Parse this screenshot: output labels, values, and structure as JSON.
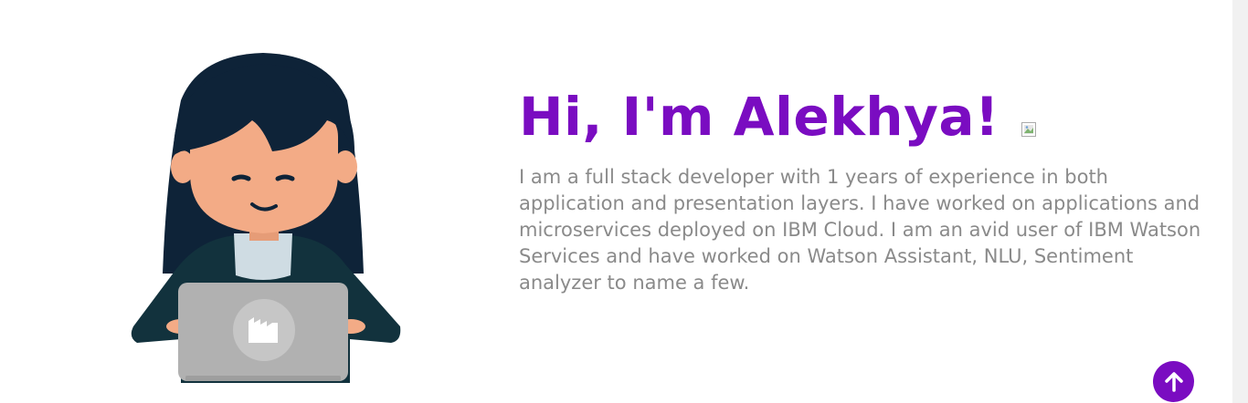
{
  "hero": {
    "greeting": "Hi, I'm Alekhya!",
    "bio": "I am a full stack developer with 1 years of experience in both application and presentation layers. I have worked on applications and microservices deployed on IBM Cloud. I am an avid user of IBM Watson Services and have worked on Watson Assistant, NLU, Sentiment analyzer to name a few.",
    "wave_image_icon": "broken-image-icon"
  },
  "illustration": {
    "subject": "developer-with-laptop",
    "colors": {
      "hair": "#0e2338",
      "skin": "#f3ab86",
      "jacket": "#12323d",
      "collar": "#cfdce3",
      "laptop": "#b1b1b1",
      "logo_circle": "#c6c6c6"
    }
  },
  "scroll_top": {
    "icon": "arrow-up-icon"
  },
  "colors": {
    "accent": "#7a0cc1",
    "body_text": "#8a8a8a",
    "background": "#ffffff"
  }
}
